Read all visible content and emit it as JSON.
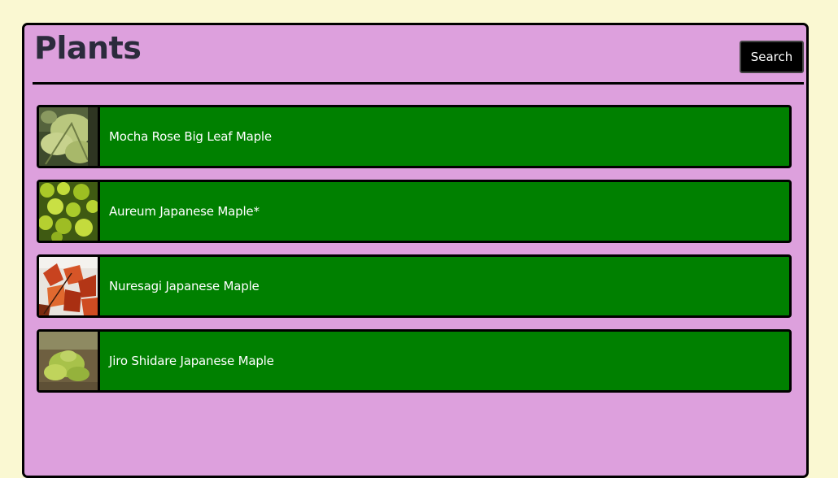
{
  "header": {
    "title": "Plants",
    "search_label": "Search"
  },
  "plants": [
    {
      "name": "Mocha Rose Big Leaf Maple",
      "image": "pale-green-leaf-photo"
    },
    {
      "name": "Aureum Japanese Maple*",
      "image": "yellow-green-foliage-photo"
    },
    {
      "name": "Nuresagi Japanese Maple",
      "image": "red-maple-leaves-photo"
    },
    {
      "name": "Jiro Shidare Japanese Maple",
      "image": "ground-sapling-photo"
    }
  ],
  "colors": {
    "page_background": "#FAF8D2",
    "panel_background": "#DDA0DD",
    "item_background": "#008000",
    "button_background": "#000000"
  }
}
